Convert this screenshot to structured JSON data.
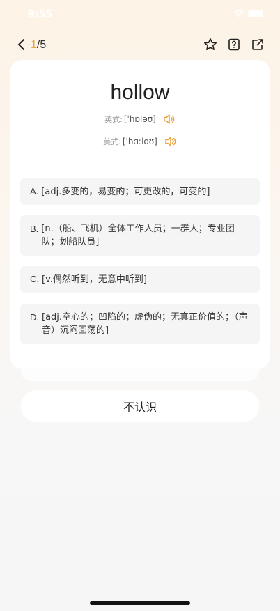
{
  "status": {
    "time": "9:55"
  },
  "nav": {
    "current": "1",
    "total": "/5"
  },
  "word": {
    "headword": "hollow",
    "uk_label": "英式:",
    "uk_ipa": "[ˈhɒləʊ]",
    "us_label": "美式:",
    "us_ipa": "[ˈhɑːloʊ]"
  },
  "options": [
    {
      "letter": "A.",
      "text": "[adj.多变的，易变的；可更改的，可变的]"
    },
    {
      "letter": "B.",
      "text": "[n.（船、飞机）全体工作人员；一群人；专业团队；划船队员]"
    },
    {
      "letter": "C.",
      "text": "[v.偶然听到，无意中听到]"
    },
    {
      "letter": "D.",
      "text": "[adj.空心的；凹陷的；虚伪的；无真正价值的；（声音）沉闷回荡的]"
    }
  ],
  "actions": {
    "unknown_label": "不认识"
  },
  "colors": {
    "accent": "#f0a23c",
    "option_bg": "#f5f5f5"
  },
  "icons": [
    "back-arrow-icon",
    "star-icon",
    "help-icon",
    "share-icon",
    "speaker-icon"
  ]
}
